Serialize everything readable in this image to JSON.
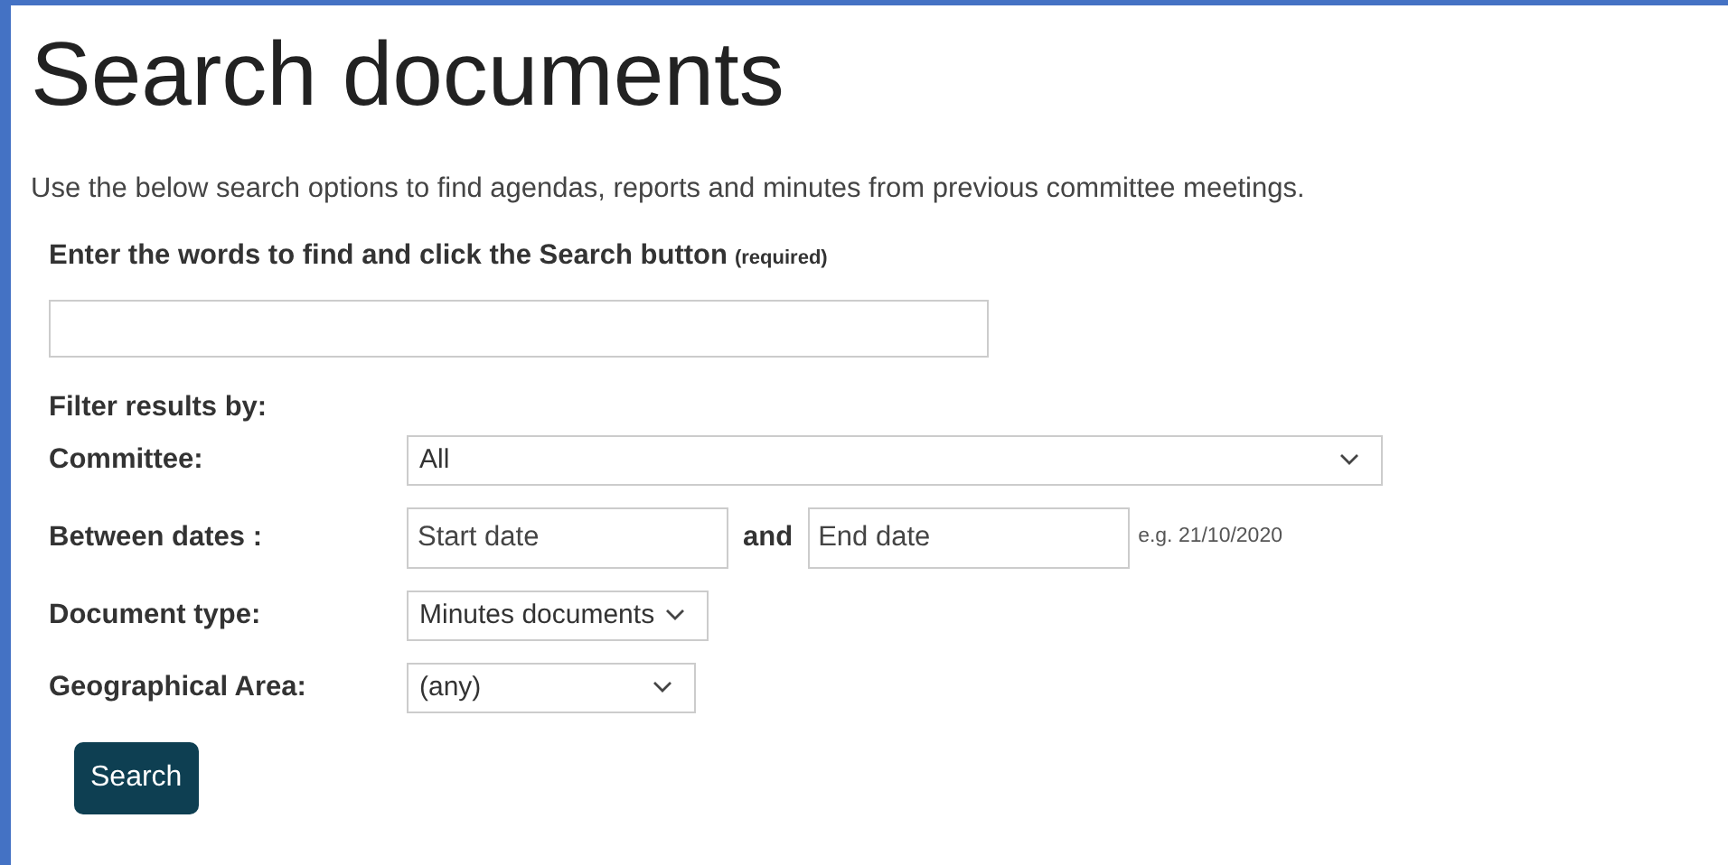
{
  "heading": "Search documents",
  "intro": "Use the below search options to find agendas, reports and minutes from previous committee meetings.",
  "keywords": {
    "label": "Enter the words to find and click the Search button",
    "note": "(required)"
  },
  "filter_heading": "Filter results by:",
  "filters": [
    {
      "kind": "select",
      "label": "Committee:",
      "value": "All"
    },
    {
      "kind": "daterange",
      "label": "Between dates :",
      "start_placeholder": "Start date",
      "joiner": "and",
      "end_placeholder": "End date",
      "hint": "e.g. 21/10/2020"
    },
    {
      "kind": "select",
      "label": "Document type:",
      "value": "Minutes documents"
    },
    {
      "kind": "select",
      "label": "Geographical Area:",
      "value": "(any)"
    }
  ],
  "search_button": "Search"
}
